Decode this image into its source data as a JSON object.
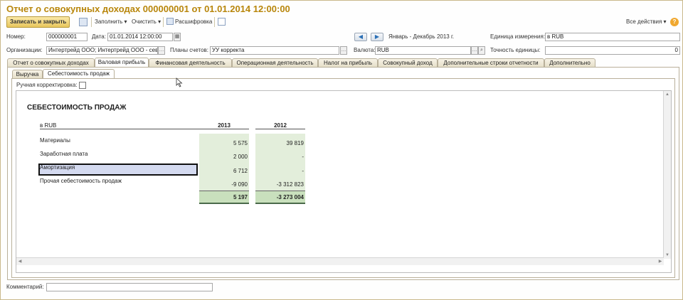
{
  "window": {
    "title": "Отчет о совокупных доходах 000000001 от 01.01.2014 12:00:00"
  },
  "toolbar": {
    "save_close": "Записать и закрыть",
    "fill": "Заполнить",
    "clear": "Очистить",
    "decode": "Расшифровка",
    "all_actions": "Все действия",
    "help": "?"
  },
  "form": {
    "number_label": "Номер:",
    "number_value": "000000001",
    "date_label": "Дата:",
    "date_value": "01.01.2014 12:00:00",
    "period_text": "Январь - Декабрь 2013 г.",
    "unit_label": "Единица измерения:",
    "unit_value": "в RUB",
    "org_label": "Организации:",
    "org_value": "Интертрейд ООО; Интертрейд ООО - севе",
    "accounts_label": "Планы счетов:",
    "accounts_value": "УУ корректа",
    "currency_label": "Валюта:",
    "currency_value": "RUB",
    "precision_label": "Точность единицы:",
    "precision_value": "0",
    "comment_label": "Комментарий:",
    "comment_value": ""
  },
  "tabs": [
    "Отчет о совокупных доходах",
    "Валовая прибыль",
    "Финансовая деятельность",
    "Операционная деятельность",
    "Налог на прибыль",
    "Совокупный доход",
    "Дополнительные строки отчетности",
    "Дополнительно"
  ],
  "subtabs": [
    "Выручка",
    "Себестоимость продаж"
  ],
  "manual_label": "Ручная корректировка:",
  "report": {
    "title": "СЕБЕСТОИМОСТЬ ПРОДАЖ",
    "unit": "в RUB",
    "col_2013": "2013",
    "col_2012": "2012",
    "rows": [
      {
        "label": "Материалы",
        "v2013": "5 575",
        "v2012": "39 819"
      },
      {
        "label": "Заработная плата",
        "v2013": "2 000",
        "v2012": "-"
      },
      {
        "label": "Амортизация",
        "v2013": "6 712",
        "v2012": "-"
      },
      {
        "label": "Прочая себестоимость продаж",
        "v2013": "-9 090",
        "v2012": "-3 312 823"
      }
    ],
    "total_2013": "5 197",
    "total_2012": "-3 273 004"
  }
}
